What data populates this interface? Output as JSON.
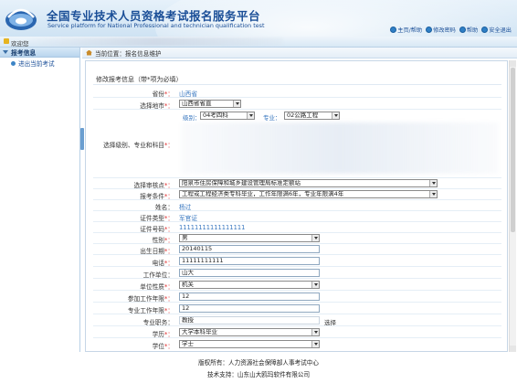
{
  "header": {
    "title_cn": "全国专业技术人员资格考试报名服务平台",
    "title_en": "Service platform for National Professional and technician qualification test",
    "links": [
      {
        "label": "主页/帮助",
        "icon": "home-icon"
      },
      {
        "label": "修改密码",
        "icon": "key-icon"
      },
      {
        "label": "帮助",
        "icon": "help-icon"
      },
      {
        "label": "安全退出",
        "icon": "exit-icon"
      }
    ]
  },
  "welcome": {
    "text": "欢迎您"
  },
  "sidebar": {
    "section": "报考信息",
    "items": [
      {
        "label": "进出当前考试"
      }
    ]
  },
  "breadcrumb": {
    "text": "当前位置：报名信息维护"
  },
  "form": {
    "title": "修改报考信息（带*项为必填）",
    "province": {
      "label": "省份",
      "value": "山西省"
    },
    "city": {
      "label": "选择地市",
      "value": "山西省省直"
    },
    "level_major": {
      "label": "选择级别、专业和科目",
      "level_label": "级别：",
      "level_value": "04考四科",
      "major_label": "专业：",
      "major_value": "02公路工程"
    },
    "exam_site": {
      "label": "选择审核点",
      "value": "阳泉市住房保障和城乡建设管理局标准定额站"
    },
    "condition": {
      "label": "报考条件",
      "value": "工程或工程经济类专科毕业，工作年限满6年，专业年限满4年"
    },
    "name": {
      "label": "姓名",
      "value": "杨过"
    },
    "id_type": {
      "label": "证件类型",
      "value": "军官证"
    },
    "id_number": {
      "label": "证件号码",
      "value": "11111111111111111"
    },
    "gender": {
      "label": "性别",
      "value": "男"
    },
    "birth_date": {
      "label": "出生日期",
      "value": "20140115"
    },
    "phone": {
      "label": "电话",
      "value": "11111111111"
    },
    "workplace": {
      "label": "工作单位",
      "value": "山大"
    },
    "unit_type": {
      "label": "单位性质",
      "value": "机关"
    },
    "work_years": {
      "label": "参加工作年限",
      "value": "12"
    },
    "pro_years": {
      "label": "专业工作年限",
      "value": "12"
    },
    "title_pos": {
      "label": "专业职务",
      "value": "教授",
      "select_label": "选择"
    },
    "education": {
      "label": "学历",
      "value": "大学本科毕业"
    },
    "degree": {
      "label": "学位",
      "value": "学士"
    }
  },
  "footer": {
    "copyright": "版权所有：人力资源社会保障部人事考试中心",
    "support": "技术支持：山东山大鸥玛软件有限公司"
  }
}
